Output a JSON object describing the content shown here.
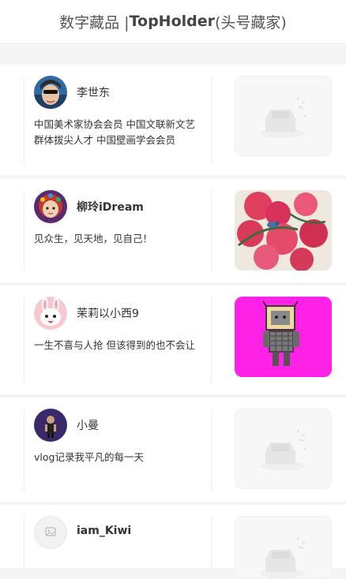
{
  "header": {
    "prefix": "数字藏品 | ",
    "brand": "TopHolder",
    "suffix": " (头号藏家)"
  },
  "colors": {
    "magenta_bg": "#ff22e6",
    "divider": "#eeeeee"
  },
  "holders": [
    {
      "name": "李世东",
      "bio": "中国美术家协会会员 中国文联新文艺群体拔尖人才 中国壁画学会会员",
      "thumb": "placeholder"
    },
    {
      "name": "柳玲iDream",
      "bio": "见众生，见天地，见自己！",
      "thumb": "flower-painting"
    },
    {
      "name": "茉莉以小西9",
      "bio": "一生不喜与人抢 但该得到的也不会让",
      "thumb": "terracotta-warrior"
    },
    {
      "name": "小曼",
      "bio": "vlog记录我平凡的每一天",
      "thumb": "placeholder"
    },
    {
      "name": "iam_Kiwi",
      "bio": "",
      "thumb": "placeholder"
    }
  ]
}
